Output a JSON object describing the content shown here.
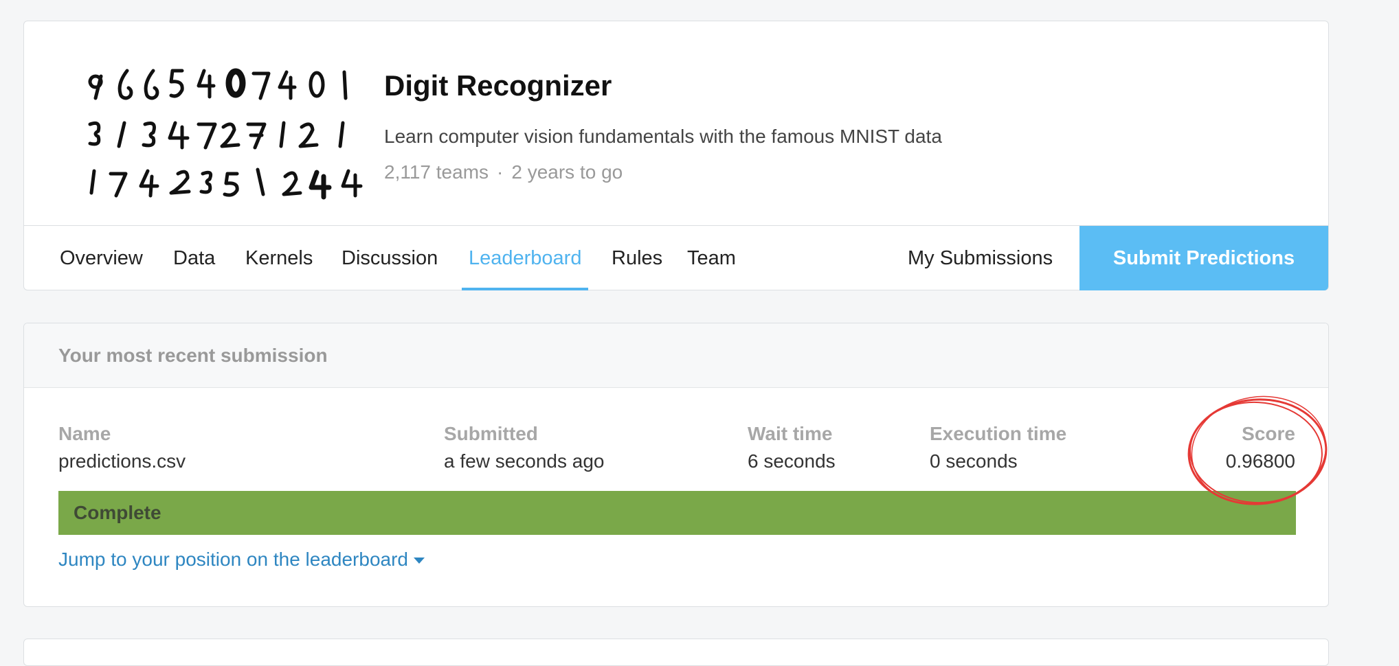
{
  "header": {
    "title": "Digit Recognizer",
    "description": "Learn computer vision fundamentals with the famous MNIST data",
    "teams": "2,117 teams",
    "separator": "·",
    "time_left": "2 years to go",
    "thumbnail_icon": "mnist-digits-image"
  },
  "tabs": [
    {
      "label": "Overview"
    },
    {
      "label": "Data"
    },
    {
      "label": "Kernels"
    },
    {
      "label": "Discussion"
    },
    {
      "label": "Leaderboard",
      "active": true
    },
    {
      "label": "Rules"
    },
    {
      "label": "Team"
    }
  ],
  "my_submissions_label": "My Submissions",
  "submit_label": "Submit Predictions",
  "submission": {
    "heading": "Your most recent submission",
    "fields": [
      {
        "label": "Name",
        "value": "predictions.csv"
      },
      {
        "label": "Submitted",
        "value": "a few seconds ago"
      },
      {
        "label": "Wait time",
        "value": "6 seconds"
      },
      {
        "label": "Execution time",
        "value": "0 seconds"
      },
      {
        "label": "Score",
        "value": "0.96800"
      }
    ],
    "status": "Complete",
    "jump_link": "Jump to your position on the leaderboard"
  },
  "colors": {
    "accent": "#4fb3ef",
    "submit_button": "#5bbdf4",
    "status_complete": "#7aa849",
    "annotation": "#e53935"
  }
}
